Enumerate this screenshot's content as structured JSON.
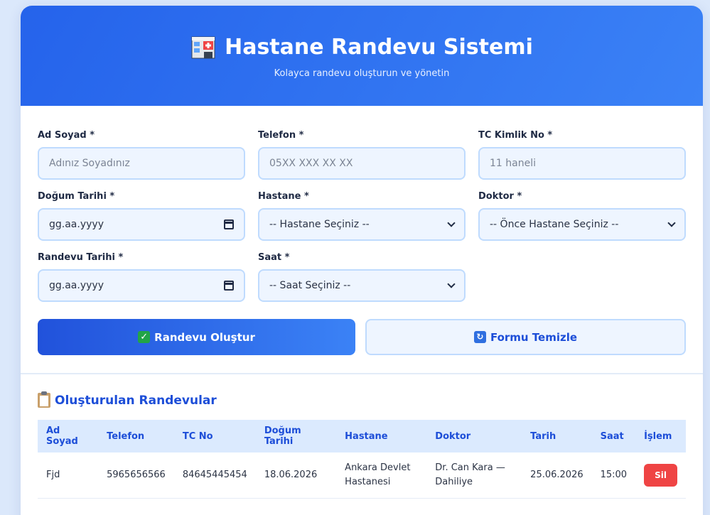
{
  "header": {
    "title": "Hastane Randevu Sistemi",
    "subtitle": "Kolayca randevu oluşturun ve yönetin"
  },
  "form": {
    "ad_soyad": {
      "label": "Ad Soyad *",
      "placeholder": "Adınız Soyadınız"
    },
    "telefon": {
      "label": "Telefon *",
      "placeholder": "05XX XXX XX XX"
    },
    "tc": {
      "label": "TC Kimlik No *",
      "placeholder": "11 haneli"
    },
    "dogum": {
      "label": "Doğum Tarihi *",
      "value": "gg.aa.yyyy"
    },
    "hastane": {
      "label": "Hastane *",
      "value": "-- Hastane Seçiniz --"
    },
    "doktor": {
      "label": "Doktor *",
      "value": "-- Önce Hastane Seçiniz --"
    },
    "randevu_tarihi": {
      "label": "Randevu Tarihi *",
      "value": "gg.aa.yyyy"
    },
    "saat": {
      "label": "Saat *",
      "value": "-- Saat Seçiniz --"
    }
  },
  "buttons": {
    "create": "Randevu Oluştur",
    "clear": "Formu Temizle"
  },
  "appointments": {
    "title": "Oluşturulan Randevular",
    "columns": [
      "Ad Soyad",
      "Telefon",
      "TC No",
      "Doğum Tarihi",
      "Hastane",
      "Doktor",
      "Tarih",
      "Saat",
      "İşlem"
    ],
    "rows": [
      {
        "ad_soyad": "Fjd",
        "telefon": "5965656566",
        "tc": "84645445454",
        "dogum": "18.06.2026",
        "hastane_1": "Ankara Devlet",
        "hastane_2": "Hastanesi",
        "doktor_1": "Dr. Can Kara —",
        "doktor_2": "Dahiliye",
        "tarih": "25.06.2026",
        "saat": "15:00",
        "action": "Sil"
      }
    ]
  },
  "icons": {
    "header": "hospital-icon",
    "create": "check-mark-icon",
    "clear": "refresh-icon",
    "list": "clipboard-icon"
  },
  "colors": {
    "primary": "#2563eb",
    "delete": "#ef4444"
  }
}
